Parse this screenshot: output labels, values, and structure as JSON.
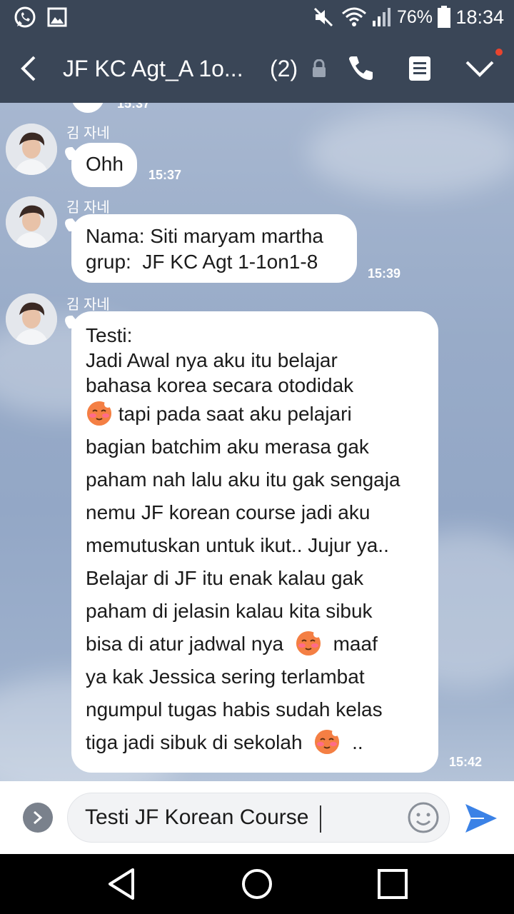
{
  "status_bar": {
    "battery_percent": "76%",
    "time": "18:34",
    "icons": [
      "whatsapp-icon",
      "image-notification-icon",
      "mute-icon",
      "wifi-icon",
      "signal-icon",
      "battery-icon"
    ]
  },
  "header": {
    "title": "JF KC Agt_A 1o...",
    "member_count": "(2)",
    "icons": [
      "back-icon",
      "lock-icon",
      "call-icon",
      "notes-icon",
      "chevron-down-icon"
    ],
    "notification_dot_color": "#e8442e"
  },
  "previous_time": "15:37",
  "messages": [
    {
      "sender": "김 자네",
      "text": "Ohh",
      "time": "15:37"
    },
    {
      "sender": "김 자네",
      "text": "Nama: Siti maryam martha\ngrup:  JF KC Agt 1-1on1-8",
      "time": "15:39"
    },
    {
      "sender": "김 자네",
      "lines": [
        "Testi:",
        "Jadi Awal nya aku itu belajar",
        "bahasa korea secara otodidak",
        "tapi pada saat aku pelajari",
        "bagian batchim aku merasa gak",
        "paham nah lalu aku itu gak sengaja",
        "nemu JF korean course jadi aku",
        "memutuskan untuk ikut..  Jujur ya..",
        "Belajar di JF itu enak kalau gak",
        "paham di jelasin kalau kita sibuk",
        "bisa di atur jadwal nya",
        "maaf",
        "ya kak Jessica sering terlambat",
        "ngumpul tugas habis sudah kelas",
        "tiga jadi sibuk di sekolah",
        ".."
      ],
      "time": "15:42"
    }
  ],
  "input": {
    "value": "Testi JF Korean Course"
  },
  "colors": {
    "header_bg": "#3a4657",
    "send_icon": "#3b82e6",
    "bubble_bg": "#ffffff"
  }
}
